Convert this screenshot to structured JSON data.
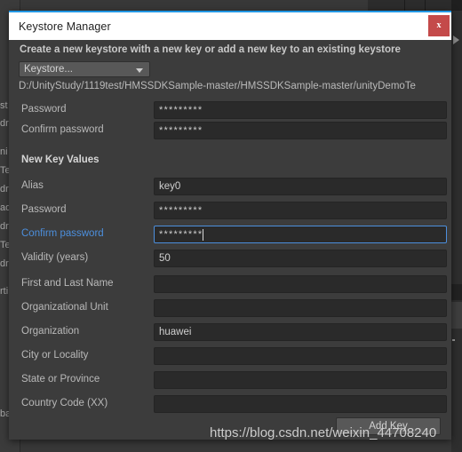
{
  "window": {
    "title": "Keystore Manager",
    "close_label": "x",
    "accent_color": "#2196e3",
    "close_color": "#c44a4a"
  },
  "dialog": {
    "headline": "Create a new keystore with a new key or add a new key to an existing keystore",
    "keystore_dropdown": {
      "selected": "Keystore...",
      "icon": "chevron-down-icon"
    },
    "keystore_path": "D:/UnityStudy/1119test/HMSSDKSample-master/HMSSDKSample-master/unityDemoTe",
    "keystore_fields": [
      {
        "label": "Password",
        "value": "*********",
        "masked": true,
        "focused": false
      },
      {
        "label": "Confirm password",
        "value": "*********",
        "masked": true,
        "focused": false
      }
    ],
    "new_key_section_title": "New Key Values",
    "new_key_fields": [
      {
        "label": "Alias",
        "value": "key0",
        "masked": false,
        "focused": false
      },
      {
        "label": "Password",
        "value": "*********",
        "masked": true,
        "focused": false
      },
      {
        "label": "Confirm password",
        "value": "*********",
        "masked": true,
        "focused": true
      },
      {
        "label": "Validity (years)",
        "value": "50",
        "masked": false,
        "focused": false
      },
      {
        "label": "First and Last Name",
        "value": "",
        "masked": false,
        "focused": false
      },
      {
        "label": "Organizational Unit",
        "value": "",
        "masked": false,
        "focused": false
      },
      {
        "label": "Organization",
        "value": "huawei",
        "masked": false,
        "focused": false
      },
      {
        "label": "City or Locality",
        "value": "",
        "masked": false,
        "focused": false
      },
      {
        "label": "State or Province",
        "value": "",
        "masked": false,
        "focused": false
      },
      {
        "label": "Country Code (XX)",
        "value": "",
        "masked": false,
        "focused": false
      }
    ],
    "add_key_button": "Add Key"
  },
  "background": {
    "left_fragments": [
      "st",
      "dr",
      "ni",
      "Te",
      "dr",
      "ad",
      "dr",
      "Te",
      "dr",
      "rti",
      "ba"
    ],
    "play_icon": "play-arrow-icon"
  },
  "watermark": "https://blog.csdn.net/weixin_44708240"
}
